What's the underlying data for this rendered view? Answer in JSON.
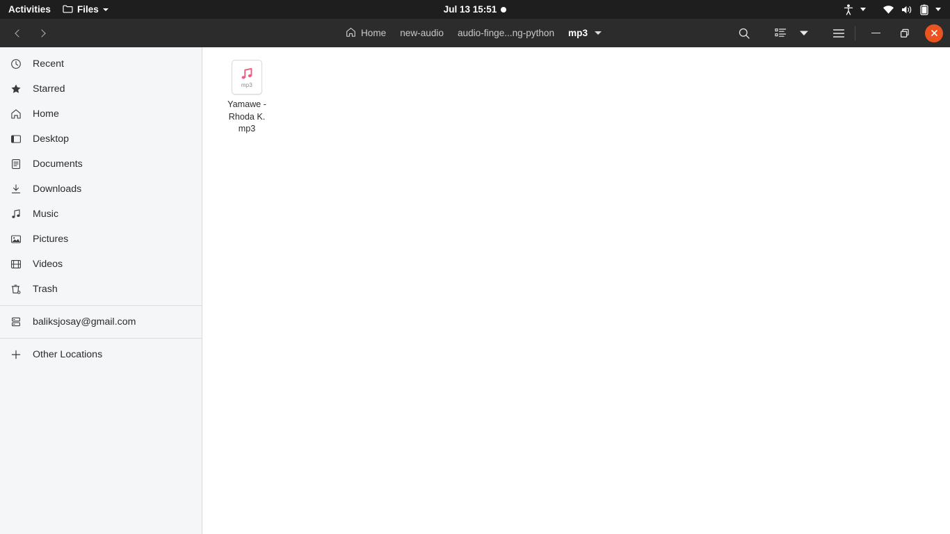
{
  "colors": {
    "topbar_bg": "#1e1e1e",
    "headerbar_bg": "#2c2c2c",
    "sidebar_bg": "#f5f6f7",
    "content_bg": "#ffffff",
    "close_button": "#e95420",
    "mp3_note": "#ef5e7e",
    "text_dark": "#2b2b2b",
    "text_light": "#ffffff"
  },
  "topbar": {
    "activities": "Activities",
    "app_name": "Files",
    "clock": "Jul 13  15:51",
    "icons": {
      "app_menu": "folder-icon",
      "app_caret": "chevron-down-icon",
      "notification_dot": "notification-dot-icon",
      "accessibility": "accessibility-icon",
      "accessibility_caret": "chevron-down-icon",
      "network": "wifi-icon",
      "volume": "volume-icon",
      "battery": "battery-icon",
      "system_caret": "chevron-down-icon"
    }
  },
  "headerbar": {
    "back": "back-icon",
    "forward": "forward-icon",
    "breadcrumbs": [
      {
        "label": "Home",
        "icon": "home-icon",
        "current": false
      },
      {
        "label": "new-audio",
        "icon": "",
        "current": false
      },
      {
        "label": "audio-finge...ng-python",
        "icon": "",
        "current": false
      },
      {
        "label": "mp3",
        "icon": "",
        "current": true
      }
    ],
    "buttons": {
      "search": "search-icon",
      "view_list": "list-view-icon",
      "view_caret": "chevron-down-icon",
      "menu": "hamburger-menu-icon",
      "minimize": "minimize-icon",
      "maximize": "maximize-restore-icon",
      "close": "close-icon"
    }
  },
  "sidebar": {
    "items": [
      {
        "label": "Recent",
        "icon": "clock-icon"
      },
      {
        "label": "Starred",
        "icon": "star-icon"
      },
      {
        "label": "Home",
        "icon": "home-icon"
      },
      {
        "label": "Desktop",
        "icon": "desktop-icon"
      },
      {
        "label": "Documents",
        "icon": "document-icon"
      },
      {
        "label": "Downloads",
        "icon": "download-icon"
      },
      {
        "label": "Music",
        "icon": "music-note-icon"
      },
      {
        "label": "Pictures",
        "icon": "image-icon"
      },
      {
        "label": "Videos",
        "icon": "film-icon"
      },
      {
        "label": "Trash",
        "icon": "trash-icon"
      }
    ],
    "account": {
      "label": "baliksjosay@gmail.com",
      "icon": "server-icon"
    },
    "other_locations": {
      "label": "Other Locations",
      "icon": "plus-icon"
    }
  },
  "content": {
    "files": [
      {
        "name_lines": [
          "Yamawe -",
          "Rhoda K.",
          "mp3"
        ],
        "full_name": "Yamawe - Rhoda K. mp3",
        "extension_label": "mp3",
        "icon": "audio-file-icon"
      }
    ]
  }
}
